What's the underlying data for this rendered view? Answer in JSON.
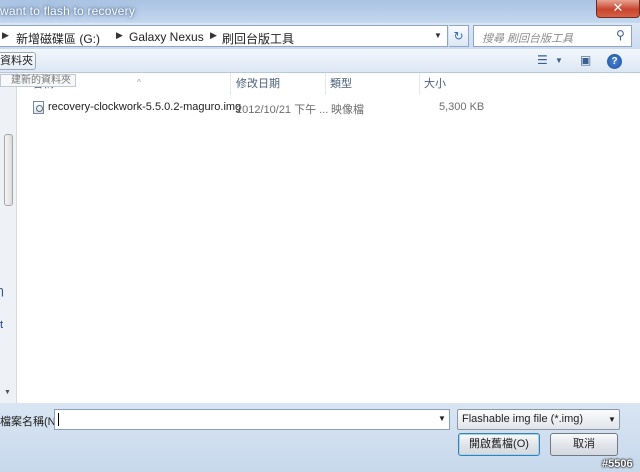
{
  "window": {
    "title": "want to flash to recovery",
    "close_glyph": "✕"
  },
  "address_bar": {
    "crumbs": [
      "新增磁碟區 (G:)",
      "Galaxy Nexus",
      "刷回台版工具"
    ],
    "search_placeholder": "搜尋 刷回台版工具"
  },
  "toolbar": {
    "new_folder_label": "資料夾"
  },
  "nav": {
    "items": [
      "›",
      "ɿ",
      "t"
    ]
  },
  "file_list": {
    "tooltip": "建新的資料夾",
    "columns": [
      "名稱",
      "修改日期",
      "類型",
      "大小"
    ],
    "rows": [
      {
        "name": "recovery-clockwork-5.5.0.2-maguro.img",
        "date": "2012/10/21 下午 ...",
        "type": "映像檔",
        "size": "5,300 KB"
      }
    ]
  },
  "bottom_bar": {
    "filename_label": "檔案名稱(N):",
    "filename_value": "",
    "filter_value": "Flashable img file (*.img)",
    "open_label": "開啟舊檔(O)",
    "cancel_label": "取消"
  },
  "watermark": "#5506"
}
